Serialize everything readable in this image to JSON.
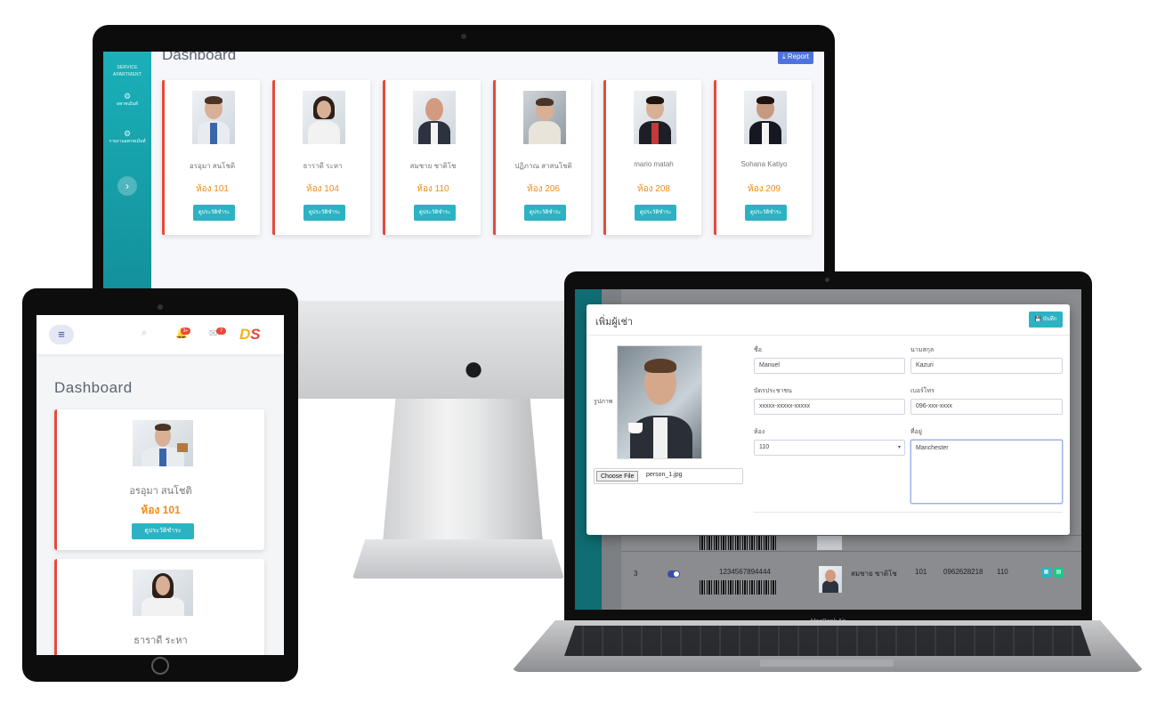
{
  "imac": {
    "title": "Dashboard",
    "report_label": "⤓ Report",
    "sidebar": {
      "brand": "SERVICE APARTMENT",
      "items": [
        {
          "label": "อพาทเม้นท์",
          "icon": "gear-icon"
        },
        {
          "label": "รายงานอพาทเม้นท์",
          "icon": "gear-icon"
        }
      ],
      "toggle_glyph": "›"
    },
    "cards": [
      {
        "name": "อรอุมา สนโชติ",
        "room": "ห้อง 101",
        "button": "ดูประวัติชำระ"
      },
      {
        "name": "ธาราดี ระหา",
        "room": "ห้อง 104",
        "button": "ดูประวัติชำระ"
      },
      {
        "name": "สมชาย ชาติโช",
        "room": "ห้อง 110",
        "button": "ดูประวัติชำระ"
      },
      {
        "name": "ปฏิภาณ สาสนโชติ",
        "room": "ห้อง 206",
        "button": "ดูประวัติชำระ"
      },
      {
        "name": "mario matah",
        "room": "ห้อง 208",
        "button": "ดูประวัติชำระ"
      },
      {
        "name": "Sohana Katiyo",
        "room": "ห้อง 209",
        "button": "ดูประวัติชำระ"
      }
    ]
  },
  "ipad": {
    "title": "Dashboard",
    "menu_glyph": "≡",
    "search_glyph": "⌕",
    "bell_glyph": "🔔",
    "bell_badge": "3+",
    "mail_glyph": "✉",
    "mail_badge": "7",
    "logo_d": "D",
    "logo_s": "S",
    "cards": [
      {
        "name": "อรอุมา สนโชติ",
        "room": "ห้อง 101",
        "button": "ดูประวัติชำระ"
      },
      {
        "name": "ธาราดี ระหา",
        "room": "",
        "button": ""
      }
    ]
  },
  "macbook": {
    "brand": "MacBook Air",
    "modal": {
      "title": "เพิ่มผู้เช่า",
      "save_label": "💾 บันทึก",
      "photo_label": "รูปภาพ",
      "file_button": "Choose File",
      "file_name": "person_1.jpg",
      "fields": {
        "first_name": {
          "label": "ชื่อ",
          "value": "Manuel"
        },
        "last_name": {
          "label": "นามสกุล",
          "value": "Kazuri"
        },
        "id_card": {
          "label": "บัตรประชาชน",
          "value": "xxxxx-xxxxx-xxxxx"
        },
        "phone": {
          "label": "เบอร์โทร",
          "value": "096-xxx-xxxx"
        },
        "room": {
          "label": "ห้อง",
          "value": "110",
          "caret": "▾"
        },
        "address": {
          "label": "ที่อยู่",
          "value": "Manchester"
        }
      }
    },
    "table_row": {
      "index": "3",
      "barcode_number": "1234567894444",
      "name": "สมชาย ชาติโช",
      "room_no": "101",
      "phone": "0962628218",
      "room": "110"
    }
  },
  "colors": {
    "accent_teal": "#2bb3c3",
    "card_border": "#e74a3b",
    "room_orange": "#f08a1c",
    "report_blue": "#4e73df"
  }
}
